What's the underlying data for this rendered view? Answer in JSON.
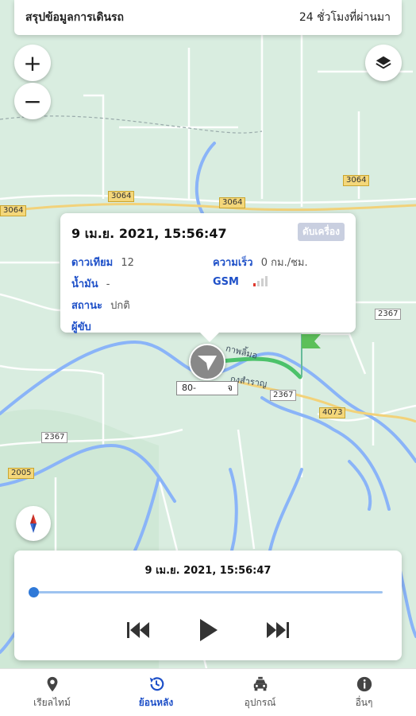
{
  "top_bar": {
    "title": "สรุปข้อมูลการเดินรถ",
    "period": "24 ชั่วโมงที่ผ่านมา"
  },
  "map_controls": {
    "zoom_in": "+",
    "zoom_out": "−",
    "layers_icon": "layers-icon",
    "compass_icon": "compass-icon"
  },
  "road_labels": [
    "3064",
    "3064",
    "3064",
    "3064",
    "2367",
    "2367",
    "2367",
    "4073",
    "2005"
  ],
  "place_labels": [
    "กาพลิ้มอ",
    "กงสำราญ"
  ],
  "popup": {
    "datetime": "9 เม.ย. 2021, 15:56:47",
    "engine_status": "ดับเครื่อง",
    "satellite_label": "ดาวเทียม",
    "satellite_value": "12",
    "speed_label": "ความเร็ว",
    "speed_value": "0 กม./ชม.",
    "fuel_label": "น้ำมัน",
    "fuel_value": "-",
    "gsm_label": "GSM",
    "gsm_bars": 1,
    "status_label": "สถานะ",
    "status_value": "ปกติ",
    "driver_label": "ผู้ขับ"
  },
  "vehicle": {
    "plate_left": "80-",
    "plate_right": "จ"
  },
  "player": {
    "time": "9 เม.ย. 2021, 15:56:47",
    "progress": 0.0
  },
  "nav": [
    {
      "label": "เรียลไทม์",
      "icon": "location-pin-icon"
    },
    {
      "label": "ย้อนหลัง",
      "icon": "history-icon"
    },
    {
      "label": "อุปกรณ์",
      "icon": "car-icon"
    },
    {
      "label": "อื่นๆ",
      "icon": "info-icon"
    }
  ],
  "colors": {
    "accent": "#1e50c8",
    "route": "#4cc26a",
    "water": "#8ab4f8",
    "map_bg": "#d9ede0",
    "road": "#ffffff"
  }
}
